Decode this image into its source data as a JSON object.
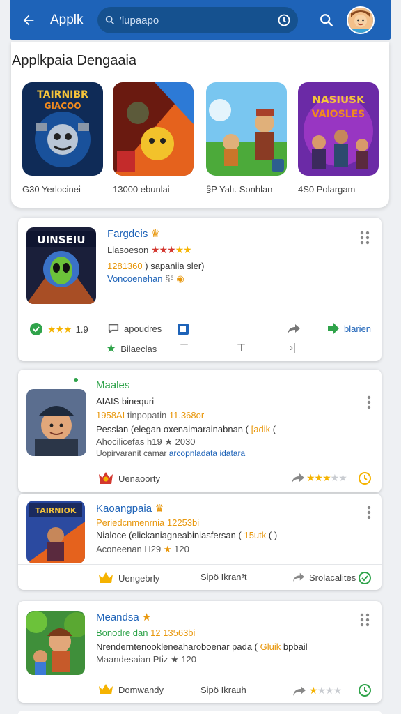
{
  "header": {
    "title": "Applk",
    "search_placeholder": "′lupaapo",
    "back_icon": "back-arrow-icon",
    "search_icon": "search-icon",
    "info_icon": "info-icon",
    "accent": "#1e63b8"
  },
  "featured": {
    "title": "Applkpaia Dengaaia",
    "items": [
      {
        "label": "G30 Yerlocinei",
        "art_text": "TAIRNIBR"
      },
      {
        "label": "13000 ebunlai",
        "art_text": ""
      },
      {
        "label": "§P Yalı. Sonhlan",
        "art_text": ""
      },
      {
        "label": "4S0 Polargam",
        "art_text": "NASIUSK"
      }
    ]
  },
  "cards": [
    {
      "name": "Fargdeis",
      "art_text": "UINSEIU",
      "line1": "Liasoeson",
      "line2_num": "1281360",
      "line2_rest": ") sapaniia sler)",
      "line3": "Voncoenehan",
      "line3_tail": "§⁶",
      "actions": {
        "rating": "1.9",
        "comment": "apoudres",
        "share": "",
        "install": "blarien",
        "sub": "Bilaeclas"
      }
    },
    {
      "name": "Maales",
      "line1": "AIAIS binequri",
      "line2_num": "1958AI",
      "line2_mid": "tinpopatin",
      "line2_val": "11.368or",
      "line3": "Pesslan (elegan oxenaimarainabnan (",
      "line3_tag": "[adik",
      "line3_end": "(",
      "line4": "Ahocilicefas",
      "line4_mid": "h19",
      "line4_val": "2030",
      "line5": "Uopirvaranit camar",
      "line5_link": "arcopnladata idatara",
      "actions": {
        "left": "Uenaoorty"
      }
    },
    {
      "name": "Kaoangpaia",
      "art_text": "TAIRNIOK",
      "line1": "Periedcnmenrnia",
      "line1_val": "12253bi",
      "line2": "Nialoce (elickaniagneabiniasfersan (",
      "line2_tag": "15utk",
      "line2_end": "(  )",
      "line3": "Aconeenan",
      "line3_mid": "H29",
      "line3_val": "120",
      "actions": {
        "left": "Uengebrly",
        "mid": "Sipö Ikran³t",
        "right": "Srolacalites"
      }
    },
    {
      "name": "Meandsa",
      "line1_g": "Bonodre dan",
      "line1_val": "12 13563bi",
      "line2": "Nrenderntenookleneaharoboenar pada (",
      "line2_tag": "Gluik",
      "line2_end": "bpbail",
      "line3": "Maandesaian",
      "line3_mid": "Ptiz",
      "line3_val": "120",
      "actions": {
        "left": "Domwandy",
        "mid": "Sipö Ikrauh"
      }
    }
  ]
}
